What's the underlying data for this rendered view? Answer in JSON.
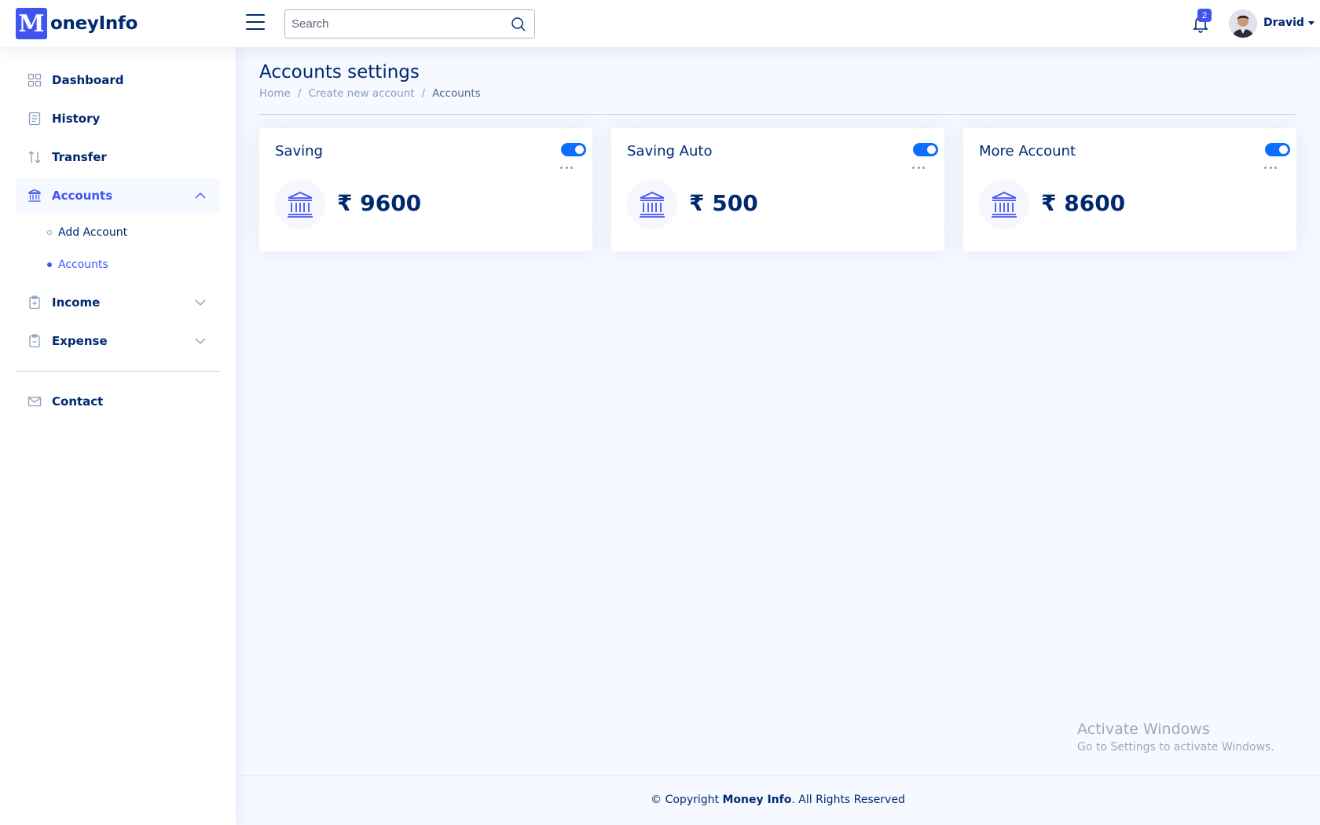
{
  "header": {
    "logo_letter": "M",
    "logo_text": "oneyInfo",
    "search_placeholder": "Search",
    "notification_count": "2",
    "user_name": "Dravid"
  },
  "sidebar": {
    "items": [
      {
        "label": "Dashboard"
      },
      {
        "label": "History"
      },
      {
        "label": "Transfer"
      },
      {
        "label": "Accounts",
        "expanded": true,
        "children": [
          {
            "label": "Add Account"
          },
          {
            "label": "Accounts",
            "active": true
          }
        ]
      },
      {
        "label": "Income"
      },
      {
        "label": "Expense"
      },
      {
        "label": "Contact"
      }
    ]
  },
  "main": {
    "title": "Accounts settings",
    "breadcrumb": [
      "Home",
      "Create new account",
      "Accounts"
    ],
    "breadcrumb_separator": "/",
    "cards": [
      {
        "title": "Saving",
        "amount": "₹ 9600",
        "enabled": true
      },
      {
        "title": "Saving Auto",
        "amount": "₹ 500",
        "enabled": true
      },
      {
        "title": "More Account",
        "amount": "₹ 8600",
        "enabled": true
      }
    ]
  },
  "watermark": {
    "line1": "Activate Windows",
    "line2": "Go to Settings to activate Windows."
  },
  "footer": {
    "prefix": "© Copyright ",
    "brand": "Money Info",
    "suffix": ". All Rights Reserved"
  },
  "colors": {
    "primary": "#4154f1",
    "navy": "#012970",
    "toggle": "#0d6efd",
    "background": "#f6f9ff"
  }
}
